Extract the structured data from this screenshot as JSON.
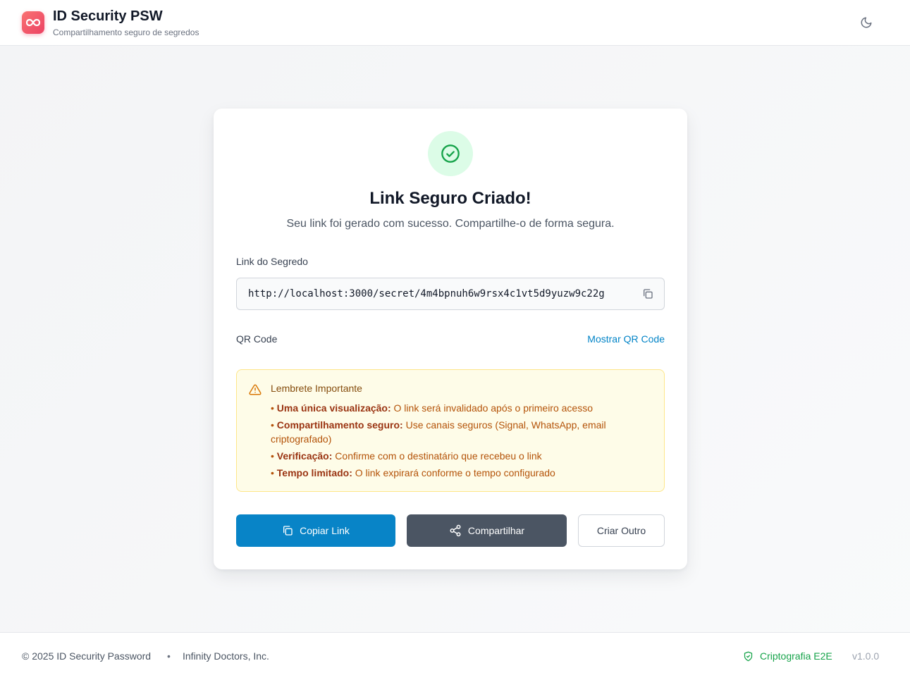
{
  "header": {
    "title": "ID Security PSW",
    "subtitle": "Compartilhamento seguro de segredos",
    "logo_icon": "infinity-icon",
    "theme_icon": "moon-icon"
  },
  "card": {
    "status_icon": "check-circle-icon",
    "title": "Link Seguro Criado!",
    "subtitle": "Seu link foi gerado com sucesso. Compartilhe-o de forma segura.",
    "link_label": "Link do Segredo",
    "link_value": "http://localhost:3000/secret/4m4bpnuh6w9rsx4c1vt5d9yuzw9c22g",
    "qr_label": "QR Code",
    "qr_action": "Mostrar QR Code"
  },
  "warning": {
    "title": "Lembrete Importante",
    "items": [
      {
        "bold": "Uma única visualização:",
        "text": " O link será invalidado após o primeiro acesso"
      },
      {
        "bold": "Compartilhamento seguro:",
        "text": " Use canais seguros (Signal, WhatsApp, email criptografado)"
      },
      {
        "bold": "Verificação:",
        "text": " Confirme com o destinatário que recebeu o link"
      },
      {
        "bold": "Tempo limitado:",
        "text": " O link expirará conforme o tempo configurado"
      }
    ]
  },
  "buttons": {
    "copy": "Copiar Link",
    "share": "Compartilhar",
    "new": "Criar Outro"
  },
  "footer": {
    "copyright": "© 2025 ID Security Password",
    "separator": "•",
    "company": "Infinity Doctors, Inc.",
    "encryption": "Criptografia E2E",
    "version": "v1.0.0"
  },
  "colors": {
    "accent": "#0884c7",
    "success": "#16a34a",
    "warning_bg": "#fefce8",
    "brand": "#ec4263"
  }
}
